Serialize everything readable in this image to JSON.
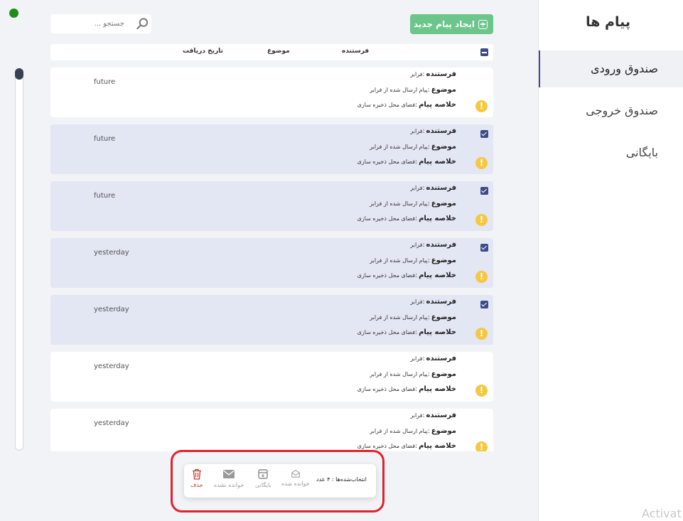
{
  "sidebar": {
    "title": "پیام ها",
    "items": [
      {
        "label": "صندوق ورودی",
        "active": true
      },
      {
        "label": "صندوق خروجی",
        "active": false
      },
      {
        "label": "بایگانی",
        "active": false
      }
    ]
  },
  "toolbar": {
    "new_message_label": "ایجاد پیام جدید",
    "search_placeholder": "جستجو ..."
  },
  "table_header": {
    "sender": "فرستنده",
    "subject": "موضوع",
    "received_date": "تاریخ دریافت"
  },
  "messages": [
    {
      "sender_label": "فرستنده",
      "sender": "فرابر",
      "subject_label": "موضوع",
      "subject": "پیام ارسال شده از فرابر",
      "summary_label": "خلاصه پیام",
      "summary": "فضای محل ذخیره سازی",
      "date": "future",
      "selected": false
    },
    {
      "sender_label": "فرستنده",
      "sender": "فرابر",
      "subject_label": "موضوع",
      "subject": "پیام ارسال شده از فرابر",
      "summary_label": "خلاصه پیام",
      "summary": "فضای محل ذخیره سازی",
      "date": "future",
      "selected": true
    },
    {
      "sender_label": "فرستنده",
      "sender": "فرابر",
      "subject_label": "موضوع",
      "subject": "پیام ارسال شده از فرابر",
      "summary_label": "خلاصه پیام",
      "summary": "فضای محل ذخیره سازی",
      "date": "future",
      "selected": true
    },
    {
      "sender_label": "فرستنده",
      "sender": "فرابر",
      "subject_label": "موضوع",
      "subject": "پیام ارسال شده از فرابر",
      "summary_label": "خلاصه پیام",
      "summary": "فضای محل ذخیره سازی",
      "date": "yesterday",
      "selected": true
    },
    {
      "sender_label": "فرستنده",
      "sender": "فرابر",
      "subject_label": "موضوع",
      "subject": "پیام ارسال شده از فرابر",
      "summary_label": "خلاصه پیام",
      "summary": "فضای محل ذخیره سازی",
      "date": "yesterday",
      "selected": true
    },
    {
      "sender_label": "فرستنده",
      "sender": "فرابر",
      "subject_label": "موضوع",
      "subject": "پیام ارسال شده از فرابر",
      "summary_label": "خلاصه پیام",
      "summary": "فضای محل ذخیره سازی",
      "date": "yesterday",
      "selected": false
    },
    {
      "sender_label": "فرستنده",
      "sender": "فرابر",
      "subject_label": "موضوع",
      "subject": "پیام ارسال شده از فرابر",
      "summary_label": "خلاصه پیام",
      "summary": "فضای محل ذخیره سازی",
      "date": "yesterday",
      "selected": false
    }
  ],
  "action_bar": {
    "selected_count": "انتخاب‌شده‌ها : ۴ عدد",
    "read_label": "خوانده شده",
    "archive_label": "بایگانی",
    "unread_label": "خوانده نشده",
    "delete_label": "حذف"
  },
  "watermark": "Activat",
  "colors": {
    "accent": "#3f4a8a",
    "new_button": "#6cc58a",
    "selected_row": "#e3e6f3",
    "warning": "#f5c842",
    "delete": "#c0392b",
    "highlight": "#e0222b",
    "status": "#1a8f1a"
  }
}
